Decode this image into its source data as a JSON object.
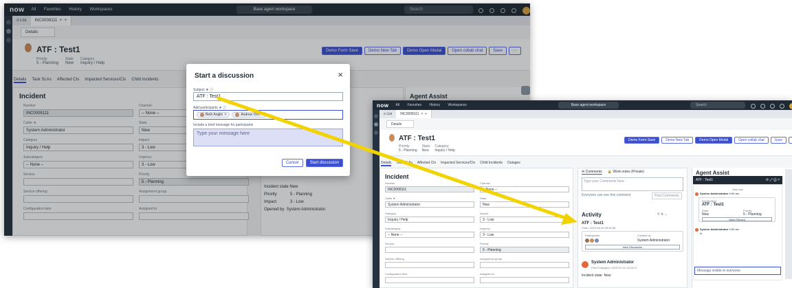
{
  "topbar": {
    "logo": "now",
    "nav": [
      "All",
      "Favorites",
      "History",
      "Workspaces"
    ],
    "context": "Base agent workspace",
    "search": "Search"
  },
  "tabs": {
    "list": "List",
    "record": "INC0008111"
  },
  "subtab": "Details",
  "record": {
    "title": "ATF : Test1",
    "priority_label": "Priority",
    "priority": "5 - Planning",
    "state_label": "State",
    "state": "New",
    "category_label": "Category",
    "category": "Inquiry / Help"
  },
  "buttons": {
    "form_save": "Demo Form Save",
    "new_tab": "Demo New Tab",
    "open_modal": "Demo Open Modal",
    "collab": "Open collab chat",
    "save": "Save",
    "more": "···"
  },
  "form_tabs": [
    "Details",
    "Task SLAs",
    "Affected CIs",
    "Impacted Services/CIs",
    "Child Incidents",
    "Outages"
  ],
  "incident": {
    "title": "Incident",
    "fields": [
      {
        "label": "Number",
        "value": "INC0008111",
        "ro": true
      },
      {
        "label": "Channel",
        "value": "-- None --"
      },
      {
        "label": "Caller ★",
        "value": "System Administrator"
      },
      {
        "label": "State",
        "value": "New"
      },
      {
        "label": "Category",
        "value": "Inquiry / Help"
      },
      {
        "label": "Impact",
        "value": "3 - Low"
      },
      {
        "label": "Subcategory",
        "value": "-- None --"
      },
      {
        "label": "Urgency",
        "value": "3 - Low"
      },
      {
        "label": "Service",
        "value": ""
      },
      {
        "label": "Priority",
        "value": "5 - Planning",
        "ro": true
      },
      {
        "label": "Service offering",
        "value": ""
      },
      {
        "label": "Assignment group",
        "value": ""
      },
      {
        "label": "Configuration item",
        "value": ""
      },
      {
        "label": "Assigned to",
        "value": ""
      }
    ]
  },
  "modal": {
    "title": "Start a discussion",
    "close": "×",
    "subject_label": "Subject ★ ⓘ",
    "subject": "ATF : Test1",
    "participants_label": "Add participants ★ ⓘ",
    "participants": [
      "Beth Anglin",
      "Andrew Och"
    ],
    "message_label": "Include a brief message for participants",
    "message_placeholder": "Type your message here",
    "cancel": "Cancel",
    "start": "Start discussion"
  },
  "activity_snip": {
    "field_changes": "Field Changes • 2019-07-22 14:03:17",
    "state_label": "Incident state",
    "state": "New",
    "priority_label": "Priority",
    "priority": "5 - Planning",
    "impact_label": "Impact",
    "impact": "3 - Low",
    "opened_label": "Opened by",
    "opened": "System Administrator"
  },
  "agent_assist": {
    "title": "Agent Assist"
  },
  "second": {
    "comments_tab": "Comments",
    "worknotes_tab": "Work notes (Private)",
    "comments_placeholder": "Type your Comments here",
    "visible_note": "Everyone can see this comment",
    "post": "Post Comments",
    "activity_title": "Activity",
    "activity_record": "ATF : Test1",
    "activity_date": "Chat • 2022-05-29 09:59:58",
    "participants_label": "Participants",
    "created_label": "Created by",
    "created_by": "System Administrator",
    "new_discussion": "New Discussion",
    "sysadmin": "System Administrator",
    "sysadmin_time": "Field Changes • 2019-07-22 14:03:17",
    "state_label": "Incident state",
    "state": "New",
    "chat_header": "ATF : Test1",
    "chat_user": "System Administrator",
    "chat_time": "9:59 am",
    "just_now": "Just now",
    "chat_rec": "INC0008111",
    "chat_title": "ATF : Test1",
    "chat_state_label": "State",
    "chat_state": "New",
    "chat_priority_label": "Priority",
    "chat_priority": "5 - Planning",
    "open_record": "Open Record",
    "chat_user2": "System Administrator",
    "chat_time2": "9:59 am",
    "chat_msg": "hi",
    "chat_input": "Message visible to everyone"
  },
  "colors": {
    "accent": "#3b4fd3",
    "arrow": "#f2d300",
    "topbar": "#1f2a35"
  }
}
